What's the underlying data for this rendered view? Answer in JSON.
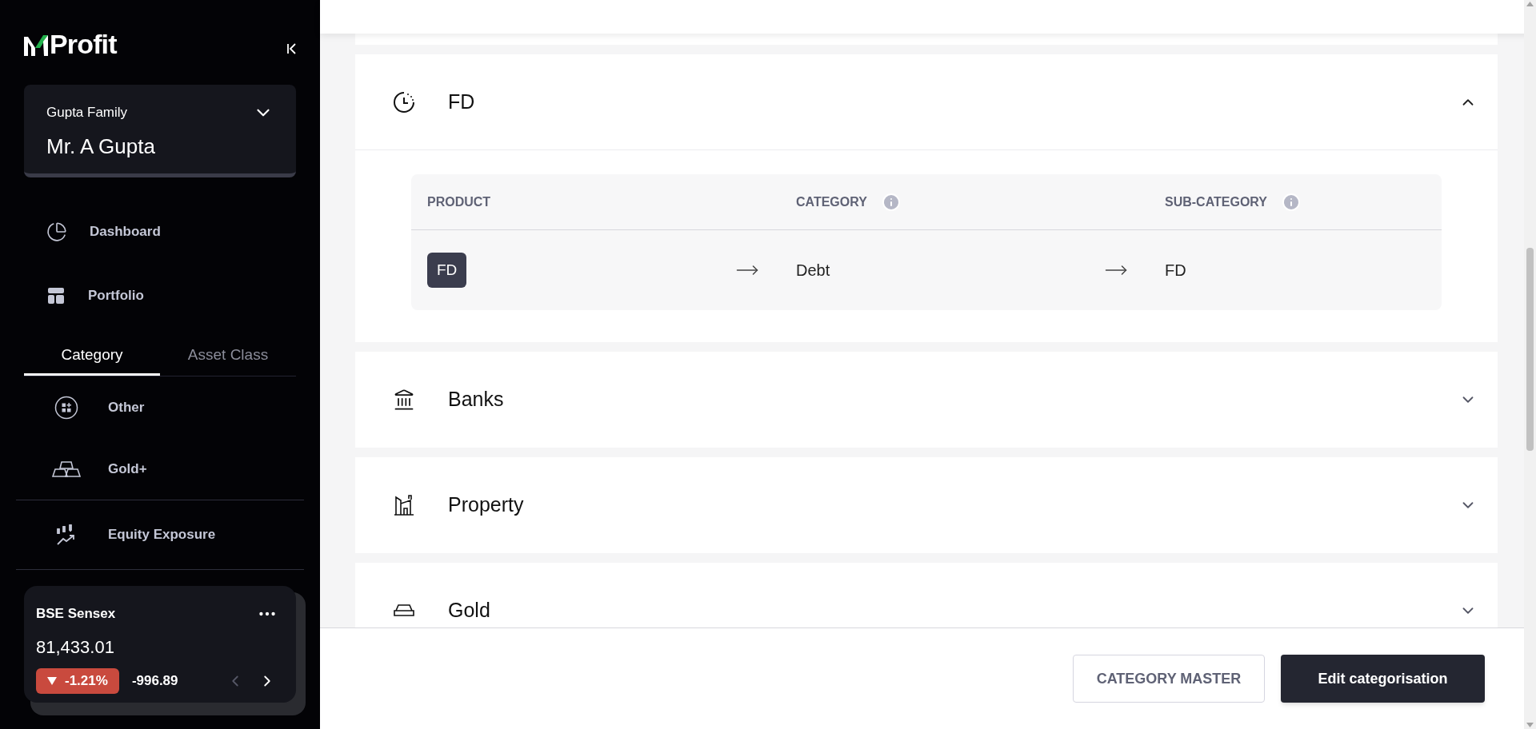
{
  "sidebar": {
    "logo": {
      "text": "Profit"
    },
    "account": {
      "family": "Gupta Family",
      "member": "Mr. A Gupta"
    },
    "nav": [
      {
        "label": "Dashboard",
        "selected": false
      },
      {
        "label": "Portfolio",
        "selected": false
      }
    ],
    "tabs": [
      {
        "label": "Category",
        "selected": true
      },
      {
        "label": "Asset Class",
        "selected": false
      }
    ],
    "categories": [
      {
        "label": "Other"
      },
      {
        "label": "Gold+"
      }
    ],
    "extra": [
      {
        "label": "Equity Exposure"
      }
    ],
    "market": {
      "name": "BSE Sensex",
      "value": "81,433.01",
      "falling": true,
      "change_percent": "-1.21%",
      "change": "-996.89"
    }
  },
  "sections": [
    {
      "title": "FD",
      "expanded": true,
      "table": {
        "columns": [
          "PRODUCT",
          "CATEGORY",
          "SUB-CATEGORY"
        ],
        "rows": [
          {
            "product": "FD",
            "category": "Debt",
            "sub_category": "FD"
          }
        ]
      }
    },
    {
      "title": "Banks",
      "expanded": false
    },
    {
      "title": "Property",
      "expanded": false
    },
    {
      "title": "Gold",
      "expanded": false
    }
  ],
  "footer": {
    "buttons": [
      {
        "label": "CATEGORY MASTER",
        "kind": "outline"
      },
      {
        "label": "Edit categorisation",
        "kind": "primary"
      }
    ]
  }
}
